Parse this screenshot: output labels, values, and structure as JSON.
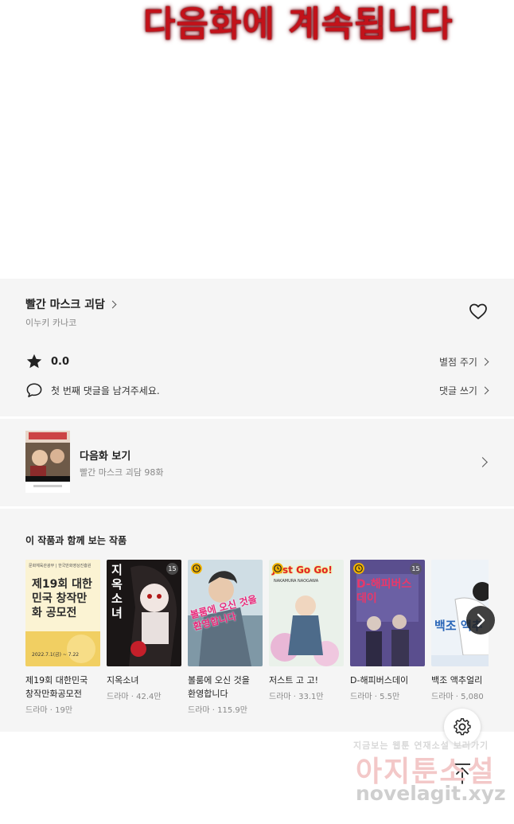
{
  "hero": {
    "text": "다음화에 계속됩니다"
  },
  "work": {
    "title": "빨간 마스크 괴담",
    "author": "이누키 카나코",
    "rating": "0.0",
    "rate_link": "별점 주기",
    "comment_prompt": "첫 번째 댓글을 남겨주세요.",
    "comment_link": "댓글 쓰기"
  },
  "next_episode": {
    "label": "다음화 보기",
    "subtitle": "빨간 마스크 괴담 98화"
  },
  "recommend": {
    "heading": "이 작품과 함께 보는 작품",
    "items": [
      {
        "title1": "제19회 대한민국",
        "title2": "창작만화공모전",
        "meta": "드라마 · 19만",
        "cover_text": "제19회 대한민국 창작만화 공모전",
        "cover_sub": "2022.7.1(금) ~ 7.22",
        "cover_top": "문화체육관광부 | 한국만화영상진흥원",
        "badge": "",
        "clock": false
      },
      {
        "title1": "지옥소녀",
        "title2": "",
        "meta": "드라마 · 42.4만",
        "cover_text": "지옥소녀",
        "badge": "15",
        "clock": false
      },
      {
        "title1": "볼룸에 오신 것을",
        "title2": "환영합니다",
        "meta": "드라마 · 115.9만",
        "cover_text": "볼룸에 오신 것을 환영합니다",
        "badge": "",
        "clock": true
      },
      {
        "title1": "저스트 고 고!",
        "title2": "",
        "meta": "드라마 · 33.1만",
        "cover_text": "Just Go Go!",
        "cover_sub": "NAKAMURA NAOGAWA",
        "badge": "",
        "clock": true
      },
      {
        "title1": "D-해피버스데이",
        "title2": "",
        "meta": "드라마 · 5.5만",
        "cover_text": "D-해피버스데이",
        "badge": "15",
        "clock": true
      },
      {
        "title1": "백조 액추얼리",
        "title2": "",
        "meta": "드라마 · 5,080",
        "cover_text": "백조 액추",
        "badge": "",
        "clock": false
      }
    ]
  },
  "watermark": {
    "line1": "지금보는 웹툰 연재소설 보러가기",
    "line2": "아지툰소설",
    "line3": "novelagit.xyz"
  },
  "colors": {
    "hero_red": "#c2121a",
    "panel_bg": "#f5f5f5",
    "badge_yellow": "#f2b400"
  },
  "icons": [
    "heart-icon",
    "star-icon",
    "comment-icon",
    "chevron-right-icon",
    "clock-icon",
    "settings-icon",
    "arrow-up-icon"
  ]
}
